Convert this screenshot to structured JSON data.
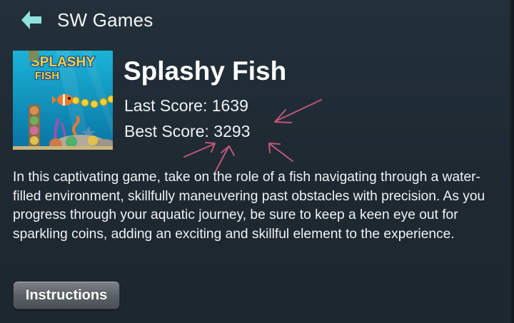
{
  "header": {
    "title": "SW Games",
    "back_icon": "back-arrow-icon",
    "accent": "#8fe3dc"
  },
  "game": {
    "title": "Splashy Fish",
    "thumbnail_logo_line1": "SPLASHY",
    "thumbnail_logo_line2": "FISH",
    "last_score_label": "Last Score: 1639",
    "best_score_label": "Best Score: 3293",
    "description": "In this captivating game, take on the role of a fish navigating through a water-filled environment, skillfully maneuvering past obstacles with precision. As you progress through your aquatic journey, be sure to keep a keen eye out for sparkling coins, adding an exciting and skillful element to the experience."
  },
  "actions": {
    "instructions_label": "Instructions"
  },
  "colors": {
    "background": "#1f2a34",
    "annotation": "#c0567c"
  }
}
